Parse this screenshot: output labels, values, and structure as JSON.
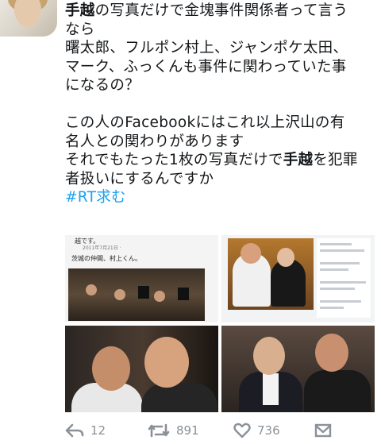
{
  "tweet": {
    "line1_bold": "手越",
    "line1_rest": "の写真だけで金塊事件関係者って言う",
    "line2": "なら",
    "line3": "曙太郎、フルポン村上、ジャンポケ太田、",
    "line4": "マーク、ふっくんも事件に関わっていた事",
    "line5": "になるの？",
    "line6": "この人のFacebookにはこれ以上沢山の有",
    "line7": "名人との関わりがあります",
    "line8_pre": "それでもたった1枚の写真だけで",
    "line8_bold": "手越",
    "line8_post": "を犯罪",
    "line9": "者扱いにするんですか",
    "hashtag": "#RT求む"
  },
  "media": {
    "fb_post_name": "越です。",
    "fb_post_date": "2011年7月21日 · ",
    "fb_post_text": "茨城の仲間、村上くん。"
  },
  "actions": {
    "reply_count": "12",
    "retweet_count": "891",
    "like_count": "736"
  },
  "colors": {
    "hashtag": "#1da1f2",
    "action_icon": "#8a9198"
  }
}
